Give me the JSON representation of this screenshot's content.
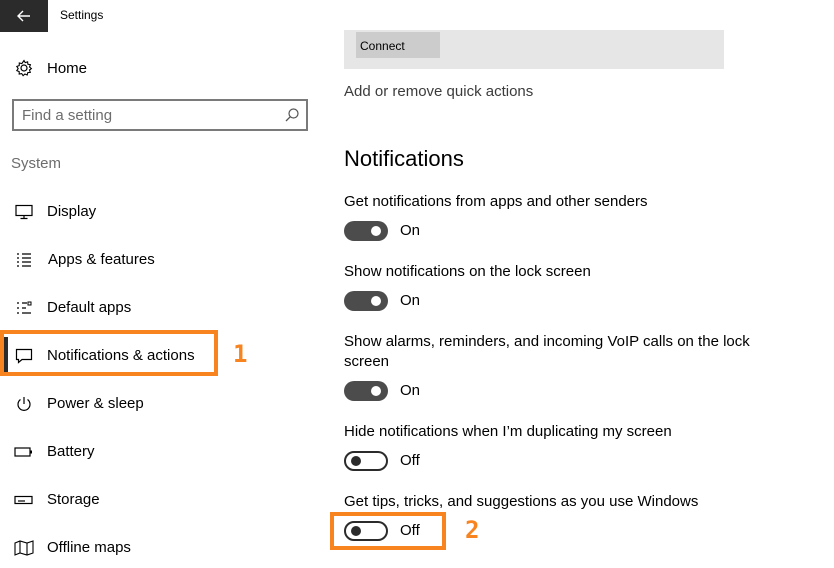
{
  "window": {
    "title": "Settings"
  },
  "sidebar": {
    "home": {
      "label": "Home",
      "icon": "gear-icon"
    },
    "search": {
      "placeholder": "Find a setting",
      "value": ""
    },
    "section": "System",
    "items": [
      {
        "label": "Display",
        "icon": "monitor-icon"
      },
      {
        "label": "Apps & features",
        "icon": "list-icon"
      },
      {
        "label": "Default apps",
        "icon": "default-apps-icon"
      },
      {
        "label": "Notifications & actions",
        "icon": "notification-icon",
        "selected": true
      },
      {
        "label": "Power & sleep",
        "icon": "power-icon"
      },
      {
        "label": "Battery",
        "icon": "battery-icon"
      },
      {
        "label": "Storage",
        "icon": "storage-icon"
      },
      {
        "label": "Offline maps",
        "icon": "map-icon"
      }
    ]
  },
  "annotations": {
    "step1": "1",
    "step2": "2",
    "highlight_color": "#f7841f"
  },
  "quick_actions": {
    "tile_label": "Connect",
    "link": "Add or remove quick actions"
  },
  "notifications": {
    "title": "Notifications",
    "settings": [
      {
        "label": "Get notifications from apps and other senders",
        "state": "On"
      },
      {
        "label": "Show notifications on the lock screen",
        "state": "On"
      },
      {
        "label": "Show alarms, reminders, and incoming VoIP calls on the lock screen",
        "state": "On"
      },
      {
        "label": "Hide notifications when I’m duplicating my screen",
        "state": "Off"
      },
      {
        "label": "Get tips, tricks, and suggestions as you use Windows",
        "state": "Off"
      }
    ]
  }
}
